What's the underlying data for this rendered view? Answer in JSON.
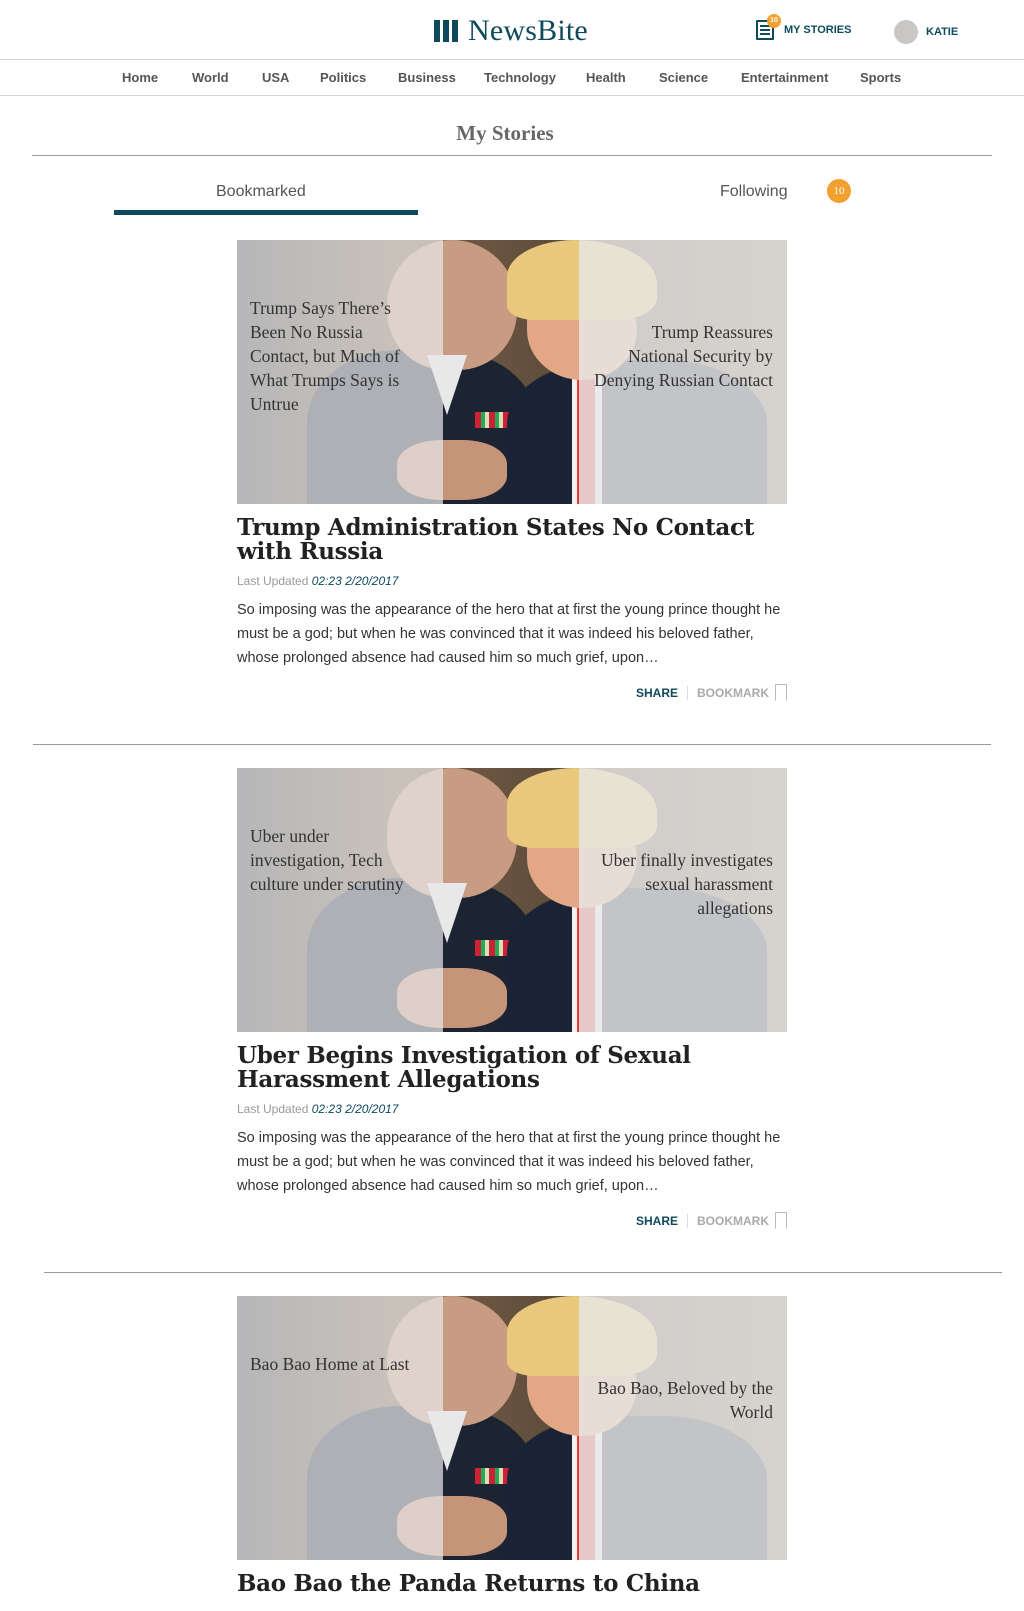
{
  "header": {
    "logo_text": "NewsBite",
    "my_stories_label": "MY STORIES",
    "my_stories_badge": "10",
    "user_name": "KATIE"
  },
  "nav": [
    "Home",
    "World",
    "USA",
    "Politics",
    "Business",
    "Technology",
    "Health",
    "Science",
    "Entertainment",
    "Sports"
  ],
  "page": {
    "title": "My Stories",
    "tabs": [
      {
        "label": "Bookmarked",
        "active": true
      },
      {
        "label": "Following",
        "badge": "10"
      }
    ]
  },
  "stories": [
    {
      "take_left": "Trump Says There’s Been No Russia Contact, but Much of What Trumps Says is Untrue",
      "take_right": "Trump Reassures National Security by Denying Russian Contact",
      "title": "Trump Administration States No Contact with Russia",
      "updated_label": "Last Updated",
      "updated_value": "02:23 2/20/2017",
      "excerpt": "So imposing was the appearance of the hero that at first the young prince thought he must be a god; but when he was convinced that it was indeed his beloved father, whose prolonged absence had caused him so much grief, upon…",
      "share_label": "SHARE",
      "bookmark_label": "BOOKMARK"
    },
    {
      "take_left": "Uber under investigation, Tech culture under scrutiny",
      "take_right": "Uber finally investigates sexual harassment allegations",
      "title": "Uber Begins Investigation of Sexual Harassment Allegations",
      "updated_label": "Last Updated",
      "updated_value": "02:23 2/20/2017",
      "excerpt": "So imposing was the appearance of the hero that at first the young prince thought he must be a god; but when he was convinced that it was indeed his beloved father, whose prolonged absence had caused him so much grief, upon…",
      "share_label": "SHARE",
      "bookmark_label": "BOOKMARK"
    },
    {
      "take_left": "Bao Bao Home at Last",
      "take_right": "Bao Bao, Beloved by the World",
      "title": "Bao Bao the Panda Returns to China"
    }
  ],
  "colors": {
    "brand": "#0e4a5c",
    "badge": "#f2a030"
  },
  "icons": [
    "logo-bars-icon",
    "newspaper-icon",
    "avatar",
    "bookmark-icon"
  ]
}
